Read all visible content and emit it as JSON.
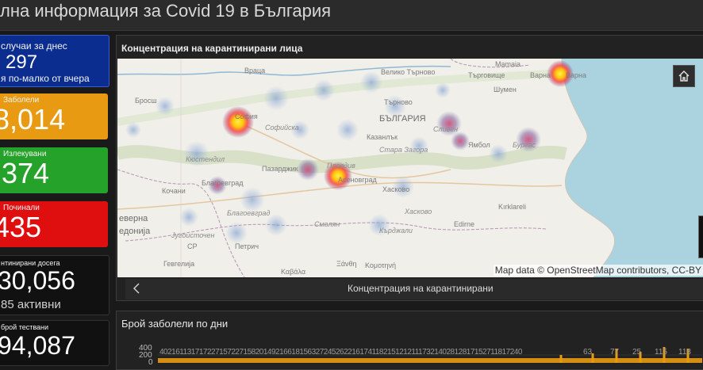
{
  "page": {
    "title": "лна информация за Covid 19 в България"
  },
  "cards": [
    {
      "label": "случаи за днес",
      "value": "297",
      "sub": "я по-малко от вчера",
      "color": "#0b2d8f"
    },
    {
      "label": "Заболели",
      "value": "8,014",
      "color": "#e89b12"
    },
    {
      "label": "Излекувани",
      "value": ",374",
      "color": "#25a22a"
    },
    {
      "label": "Починали",
      "value": "435",
      "color": "#e00f0f"
    },
    {
      "label": "нтинирани досега",
      "value": "30,056",
      "sub": "85 активни",
      "color": "#111111"
    },
    {
      "label": "брой тествани",
      "value": "94,087",
      "color": "#111111"
    }
  ],
  "map_panel": {
    "title": "Концентрация на карантинирани лица",
    "attribution": "Map data © OpenStreetMap contributors, CC-BY",
    "footer_label": "Концентрация на карантинирани",
    "home_icon": "home-icon",
    "prev_icon": "chevron-left-icon",
    "labels": {
      "mamaia": "Mamaia",
      "vratsa": "Враца",
      "veliko": "Велико Търново",
      "targovishte": "Търговище",
      "varna": "Варна",
      "varna2": "Варна",
      "brosh": "Бросш",
      "turnovo": "Търново",
      "sofia": "София",
      "sofia2": "Софийска",
      "bulgaria": "БЪЛГАРИЯ",
      "kazanlak": "Казанлък",
      "sliven": "Сливен",
      "yambol": "Ямбол",
      "burgas": "Бургас",
      "stara": "Стара Загора",
      "kyustendil": "Кюстендил",
      "pazardzhik": "Пазарджик",
      "plovdiv": "Пловдив",
      "asenovgrad": "Асеновград",
      "haskovo": "Хасково",
      "haskovo2": "Хасково",
      "blagoevgrad": "Благоевград",
      "blagoevgrad2": "Благоевград",
      "kochani": "Кочани",
      "smolyan": "Смолян",
      "kardzhali": "Кърджали",
      "kirklareli": "Kırklareli",
      "edirne": "Edirne",
      "severna": "еверна",
      "makedonija": "едонија",
      "jugo": "Југоисточен",
      "sr": "СР",
      "petrich": "Петрич",
      "xanthi": "Ξάνθη",
      "komotini": "Κομοτηνή",
      "gevgelija": "Гевгелија",
      "kavala": "Καβάλα",
      "shumen": "Шумен"
    }
  },
  "chart_panel": {
    "title": "Брой заболели по дни",
    "y_ticks": [
      "400",
      "200",
      "0"
    ],
    "strip_text": "4021611317172271572271582014921661815632724526221617411821512121117321402812817152711817240",
    "right_labels": [
      "63",
      "77",
      "25",
      "115",
      "118"
    ]
  }
}
